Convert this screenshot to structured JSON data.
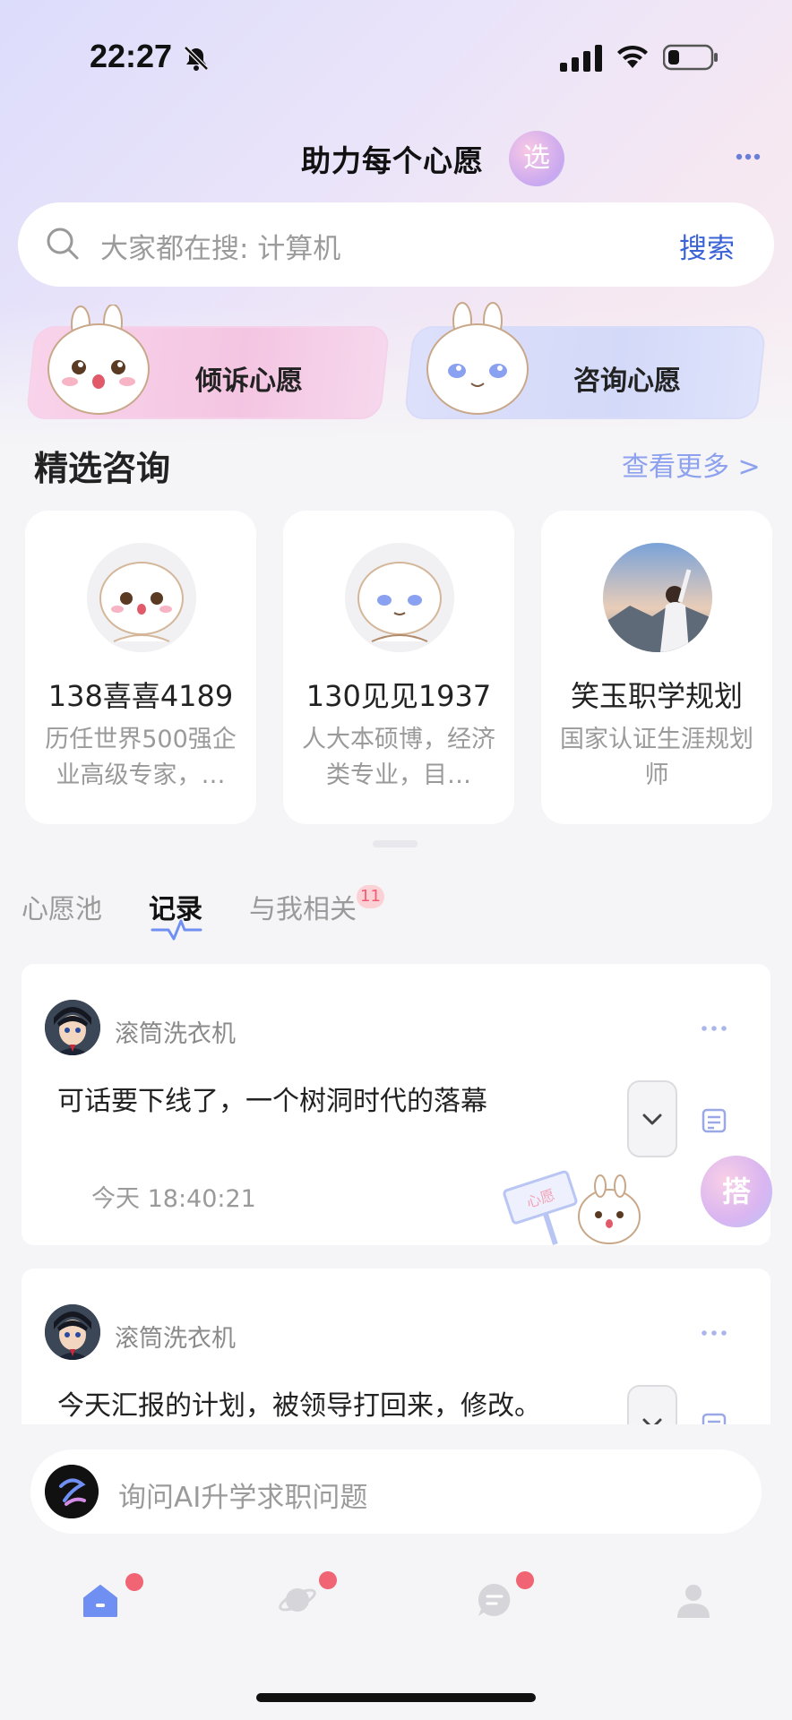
{
  "status_bar": {
    "time": "22:27"
  },
  "header": {
    "title": "助力每个心愿",
    "badge": "选"
  },
  "search": {
    "placeholder": "大家都在搜: 计算机",
    "button": "搜索"
  },
  "wish_cards": [
    {
      "label": "倾诉心愿"
    },
    {
      "label": "咨询心愿"
    }
  ],
  "featured": {
    "title": "精选咨询",
    "see_more": "查看更多 >",
    "items": [
      {
        "name": "138喜喜4189",
        "desc": "历任世界500强企业高级专家，…"
      },
      {
        "name": "130见见1937",
        "desc": "人大本硕博，经济类专业，目…"
      },
      {
        "name": "笑玉职学规划",
        "desc": "国家认证生涯规划师"
      }
    ]
  },
  "tabs": {
    "items": [
      {
        "label": "心愿池"
      },
      {
        "label": "记录"
      },
      {
        "label": "与我相关"
      }
    ],
    "related_count": "11"
  },
  "posts": [
    {
      "user": "滚筒洗衣机",
      "text": "可话要下线了，一个树洞时代的落幕",
      "time": "今天 18:40:21"
    },
    {
      "user": "滚筒洗衣机",
      "text": "今天汇报的计划，被领导打回来，修改。"
    }
  ],
  "sign_text": "心愿",
  "float_button": "搭",
  "ai_input": {
    "placeholder": "询问AI升学求职问题"
  },
  "colors": {
    "accent": "#3b63d6",
    "see_more": "#8da1ee",
    "badge_red": "#f06474",
    "nav_active": "#6f8ff2"
  },
  "icons": [
    "bell-slash-icon",
    "signal-icon",
    "wifi-icon",
    "battery-icon",
    "more-icon",
    "search-icon",
    "chevron-down-icon",
    "note-icon",
    "home-icon",
    "planet-icon",
    "chat-icon",
    "profile-icon"
  ]
}
